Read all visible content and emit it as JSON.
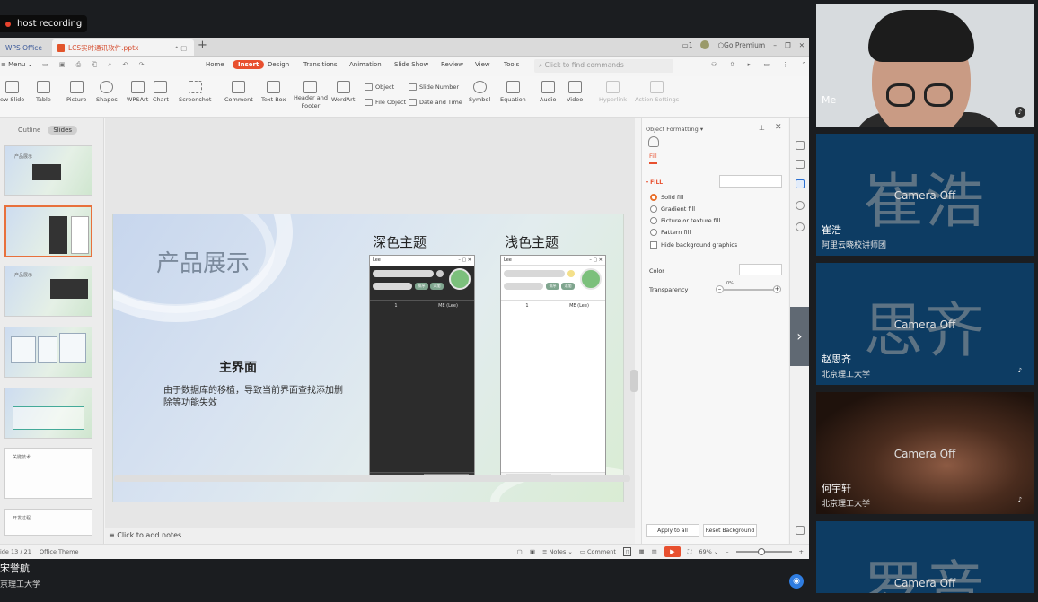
{
  "recording": {
    "label": "host recording"
  },
  "tabs": {
    "home": "WPS Office",
    "file": "LCS实时通讯软件.pptx",
    "go_premium": "Go Premium"
  },
  "menu": {
    "menu_label": "Menu",
    "items": [
      "Home",
      "Insert",
      "Design",
      "Transitions",
      "Animation",
      "Slide Show",
      "Review",
      "View",
      "Tools"
    ],
    "search_placeholder": "Click to find commands"
  },
  "ribbon": {
    "new_slide": "ew Slide",
    "table": "Table",
    "picture": "Picture",
    "shapes": "Shapes",
    "wpsart": "WPSArt",
    "chart": "Chart",
    "screenshot": "Screenshot",
    "comment": "Comment",
    "text_box": "Text Box",
    "header_footer_1": "Header and",
    "header_footer_2": "Footer",
    "wordart": "WordArt",
    "object": "Object",
    "file_object": "File Object",
    "slide_number": "Slide Number",
    "date_time": "Date and Time",
    "symbol": "Symbol",
    "equation": "Equation",
    "audio": "Audio",
    "video": "Video",
    "hyperlink": "Hyperlink",
    "action_settings": "Action Settings"
  },
  "left_panel": {
    "outline": "Outline",
    "slides": "Slides",
    "thumb_numbers": [
      "2",
      "3",
      "4",
      "5",
      "6",
      "7",
      "8"
    ],
    "thumb2_title": "产品展示",
    "thumb4_title": "产品展示",
    "thumb7_title": "关键技术",
    "thumb8_title": "开发过程"
  },
  "slide": {
    "title": "产品展示",
    "main_label": "主界面",
    "description": "由于数据库的移植，导致当前界面查找添加删除等功能失效",
    "dark_theme_label": "深色主题",
    "light_theme_label": "浅色主题",
    "window_title": "Lee",
    "btn_sort": "排序",
    "btn_add": "添加",
    "col1": "1",
    "col2": "ME (Lee)"
  },
  "notes": {
    "placeholder": "Click to add notes"
  },
  "format_panel": {
    "title": "Object Formatting",
    "fill_tab": "Fill",
    "fill_heading": "FILL",
    "options": [
      "Solid fill",
      "Gradient fill",
      "Picture or texture fill",
      "Pattern fill"
    ],
    "hide_bg": "Hide background graphics",
    "color": "Color",
    "transparency": "Transparency",
    "transparency_value": "0%",
    "apply_all": "Apply to all",
    "reset_bg": "Reset Background"
  },
  "status": {
    "slide_info": "ide 13 / 21",
    "theme": "Office Theme",
    "notes": "Notes",
    "comment": "Comment",
    "zoom": "69%"
  },
  "presenter": {
    "name": "宋誉航",
    "org": "京理工大学"
  },
  "participants": [
    {
      "name": "Me",
      "org": "",
      "big": "",
      "camera": ""
    },
    {
      "name": "崔浩",
      "org": "阿里云晓校讲师团",
      "big": "崔浩",
      "camera": "Camera Off"
    },
    {
      "name": "赵思齐",
      "org": "北京理工大学",
      "big": "思齐",
      "camera": "Camera Off"
    },
    {
      "name": "何宇轩",
      "org": "北京理工大学",
      "big": "",
      "camera": "Camera Off"
    },
    {
      "name": "",
      "org": "",
      "big": "罗音",
      "camera": "Camera Off"
    }
  ],
  "colors": {
    "accent": "#e8502f",
    "tile_bg": "#0d3c63",
    "rec_dot": "#e8432e"
  }
}
